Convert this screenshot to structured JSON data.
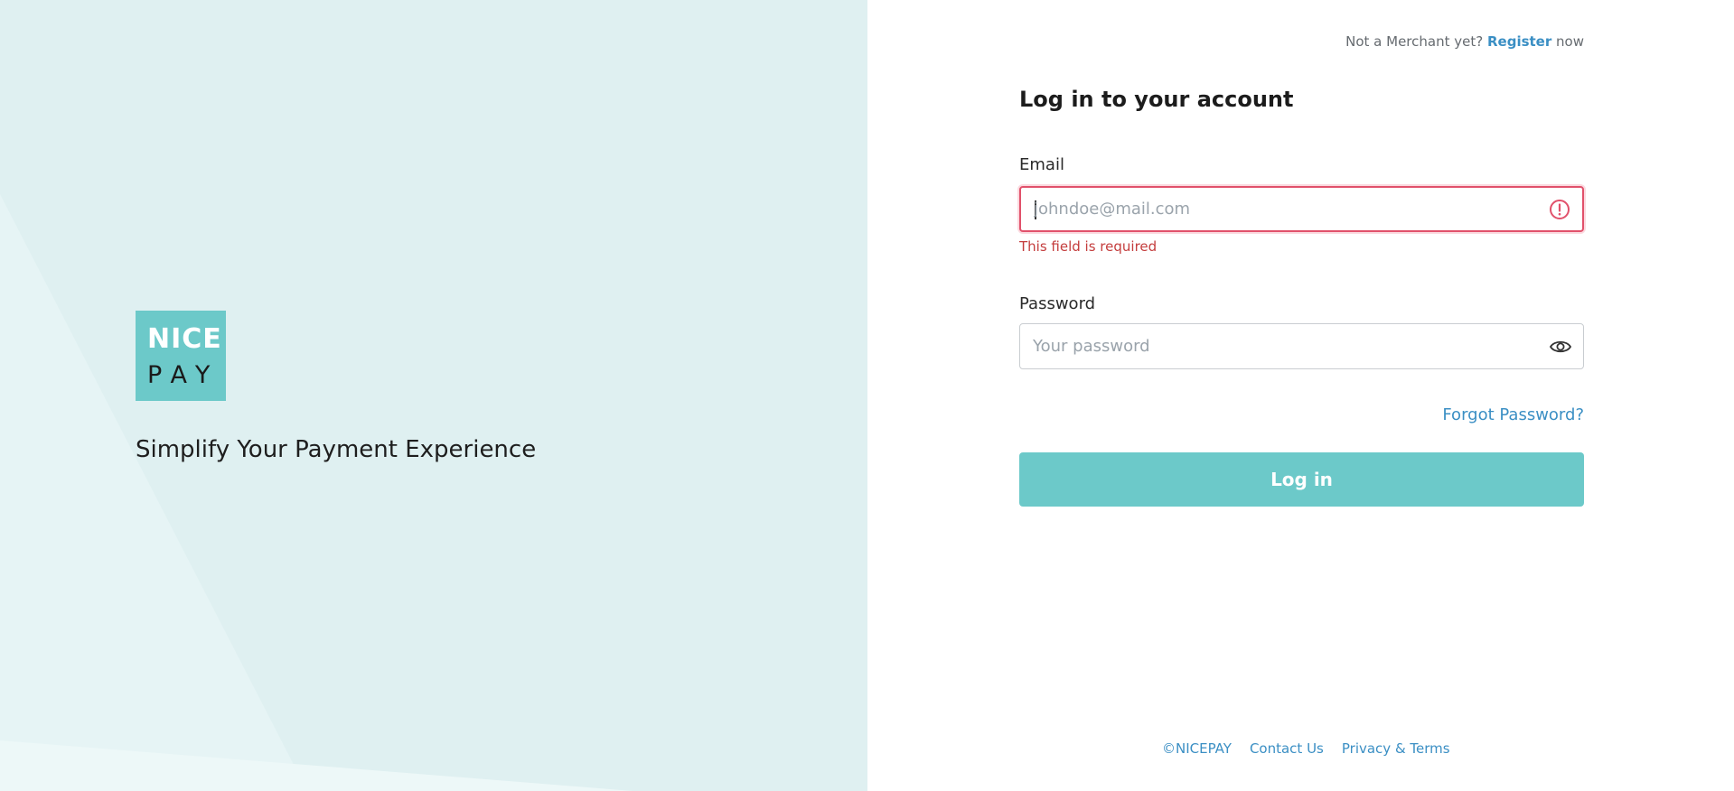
{
  "brand": {
    "logo_line1": "NICE",
    "logo_line2": "PAY",
    "tagline": "Simplify Your Payment Experience",
    "primary_color": "#6cc9c9",
    "left_panel_bg": "#dff0f1"
  },
  "header": {
    "register_prefix": "Not a Merchant yet?",
    "register_link": "Register",
    "register_suffix": "now"
  },
  "form": {
    "title": "Log in to your account",
    "email_label": "Email",
    "email_placeholder": "johndoe@mail.com",
    "email_value": "",
    "email_error": "This field is required",
    "email_error_icon": "alert-circle-icon",
    "password_label": "Password",
    "password_placeholder": "Your password",
    "password_value": "",
    "password_toggle_icon": "eye-icon",
    "forgot_password": "Forgot Password?",
    "login_button": "Log in"
  },
  "footer": {
    "copyright": "©NICEPAY",
    "contact": "Contact Us",
    "privacy": "Privacy & Terms"
  },
  "colors": {
    "link": "#3b8fc4",
    "error": "#e1516b"
  }
}
